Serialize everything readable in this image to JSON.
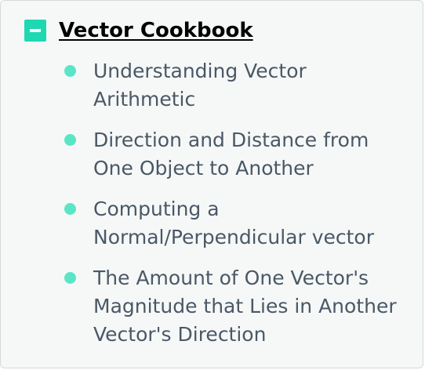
{
  "section": {
    "title": "Vector Cookbook",
    "toggle_icon": "minus-icon",
    "accent_color": "#1ed8b2",
    "items": [
      {
        "label": "Understanding Vector Arithmetic"
      },
      {
        "label": "Direction and Distance from One Object to Another"
      },
      {
        "label": "Computing a Normal/Perpendicular vector"
      },
      {
        "label": "The Amount of One Vector's Magnitude that Lies in Another Vector's Direction"
      }
    ]
  }
}
